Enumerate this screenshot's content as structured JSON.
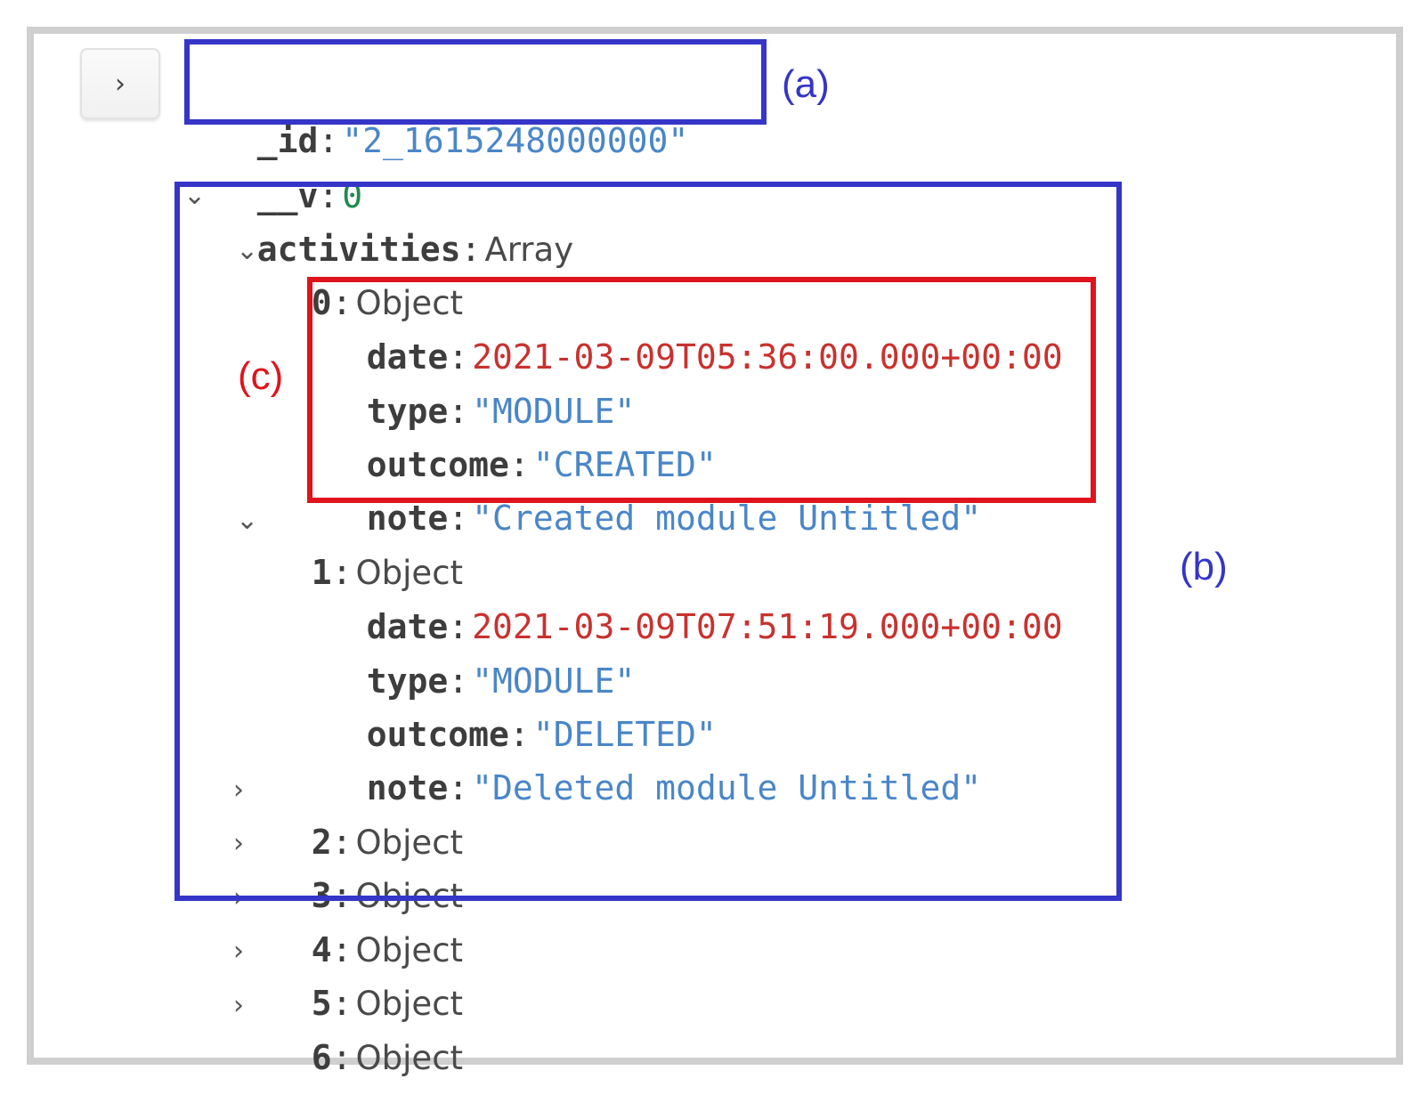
{
  "document": {
    "id_field": {
      "key": "_id",
      "value": "\"2_1615248000000\""
    },
    "v_field": {
      "key": "__v",
      "value": "0"
    },
    "activities": {
      "key": "activities",
      "type": "Array",
      "items": [
        {
          "index": "0",
          "type": "Object",
          "fields": [
            {
              "key": "date",
              "value": "2021-03-09T05:36:00.000+00:00"
            },
            {
              "key": "type",
              "value": "\"MODULE\""
            },
            {
              "key": "outcome",
              "value": "\"CREATED\""
            },
            {
              "key": "note",
              "value": "\"Created module Untitled\""
            }
          ]
        },
        {
          "index": "1",
          "type": "Object",
          "fields": [
            {
              "key": "date",
              "value": "2021-03-09T07:51:19.000+00:00"
            },
            {
              "key": "type",
              "value": "\"MODULE\""
            },
            {
              "key": "outcome",
              "value": "\"DELETED\""
            },
            {
              "key": "note",
              "value": "\"Deleted module Untitled\""
            }
          ]
        },
        {
          "index": "2",
          "type": "Object"
        },
        {
          "index": "3",
          "type": "Object"
        },
        {
          "index": "4",
          "type": "Object"
        },
        {
          "index": "5",
          "type": "Object"
        },
        {
          "index": "6",
          "type": "Object"
        }
      ]
    }
  },
  "annotations": {
    "a": "(a)",
    "b": "(b)",
    "c": "(c)"
  },
  "colors": {
    "annotation_blue": "#3535c8",
    "annotation_red": "#e0131c",
    "string_value": "#4a86c8",
    "date_value": "#c8322f",
    "number_value": "#1f8a4c"
  },
  "icons": {
    "expand": "chevron-right-icon",
    "expanded": "chevron-down-icon",
    "collapsed": "chevron-right-icon"
  }
}
